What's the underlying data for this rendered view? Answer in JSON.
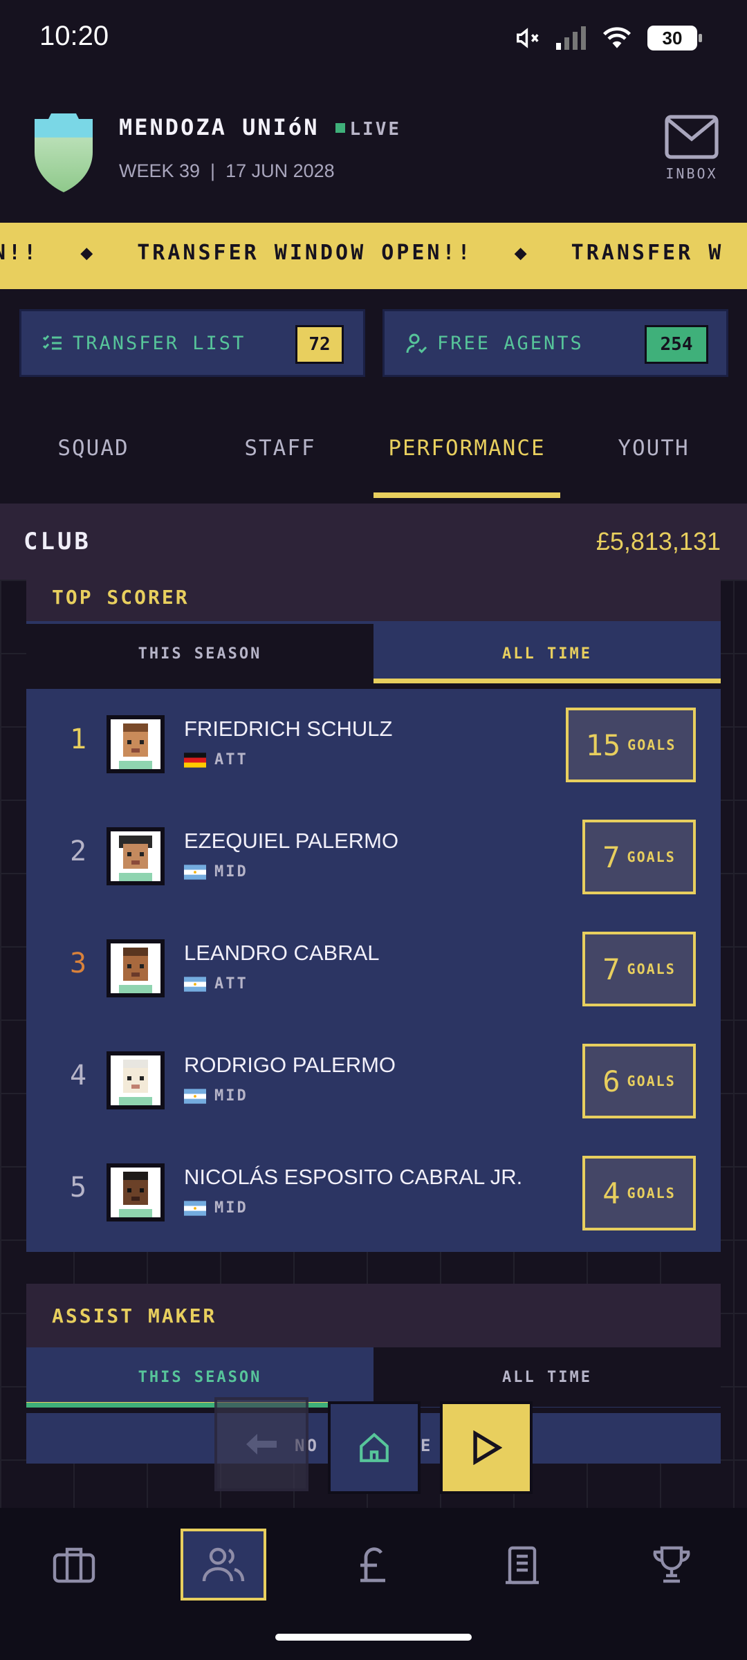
{
  "status": {
    "time": "10:20",
    "battery": "30"
  },
  "header": {
    "club_name": "MENDOZA UNIóN",
    "live_label": "LIVE",
    "week": "WEEK 39",
    "date": "17 JUN 2028",
    "inbox_label": "INBOX"
  },
  "ticker": {
    "text_a": "N!!",
    "text_b": "TRANSFER WINDOW OPEN!!",
    "text_c": "TRANSFER W"
  },
  "quick": {
    "transfer_list": "TRANSFER LIST",
    "transfer_count": "72",
    "free_agents": "FREE AGENTS",
    "free_count": "254"
  },
  "tabs": [
    {
      "label": "SQUAD"
    },
    {
      "label": "STAFF"
    },
    {
      "label": "PERFORMANCE"
    },
    {
      "label": "YOUTH"
    }
  ],
  "club_bar": {
    "label": "CLUB",
    "balance": "£5,813,131"
  },
  "top_scorer": {
    "title": "TOP SCORER",
    "seg_a": "THIS SEASON",
    "seg_b": "ALL TIME",
    "goals_label": "GOALS",
    "players": [
      {
        "rank": "1",
        "name": "FRIEDRICH SCHULZ",
        "pos": "ATT",
        "goals": "15",
        "rank_color": "#e8cf5e",
        "flag": "de"
      },
      {
        "rank": "2",
        "name": "EZEQUIEL PALERMO",
        "pos": "MID",
        "goals": "7",
        "rank_color": "#b6b4c8",
        "flag": "ar"
      },
      {
        "rank": "3",
        "name": "LEANDRO CABRAL",
        "pos": "ATT",
        "goals": "7",
        "rank_color": "#d9823b",
        "flag": "ar"
      },
      {
        "rank": "4",
        "name": "RODRIGO PALERMO",
        "pos": "MID",
        "goals": "6",
        "rank_color": "#b6b4c8",
        "flag": "ar"
      },
      {
        "rank": "5",
        "name": "NICOLÁS ESPOSITO CABRAL JR.",
        "pos": "MID",
        "goals": "4",
        "rank_color": "#b6b4c8",
        "flag": "ar"
      }
    ]
  },
  "assist_maker": {
    "title": "ASSIST MAKER",
    "seg_a": "THIS SEASON",
    "seg_b": "ALL TIME",
    "empty_partial_a": "NO",
    "empty_partial_b": "E"
  },
  "colors": {
    "accent": "#e8cf5e",
    "green": "#57c59a",
    "panel": "#2c3563",
    "bg": "#16121f"
  }
}
